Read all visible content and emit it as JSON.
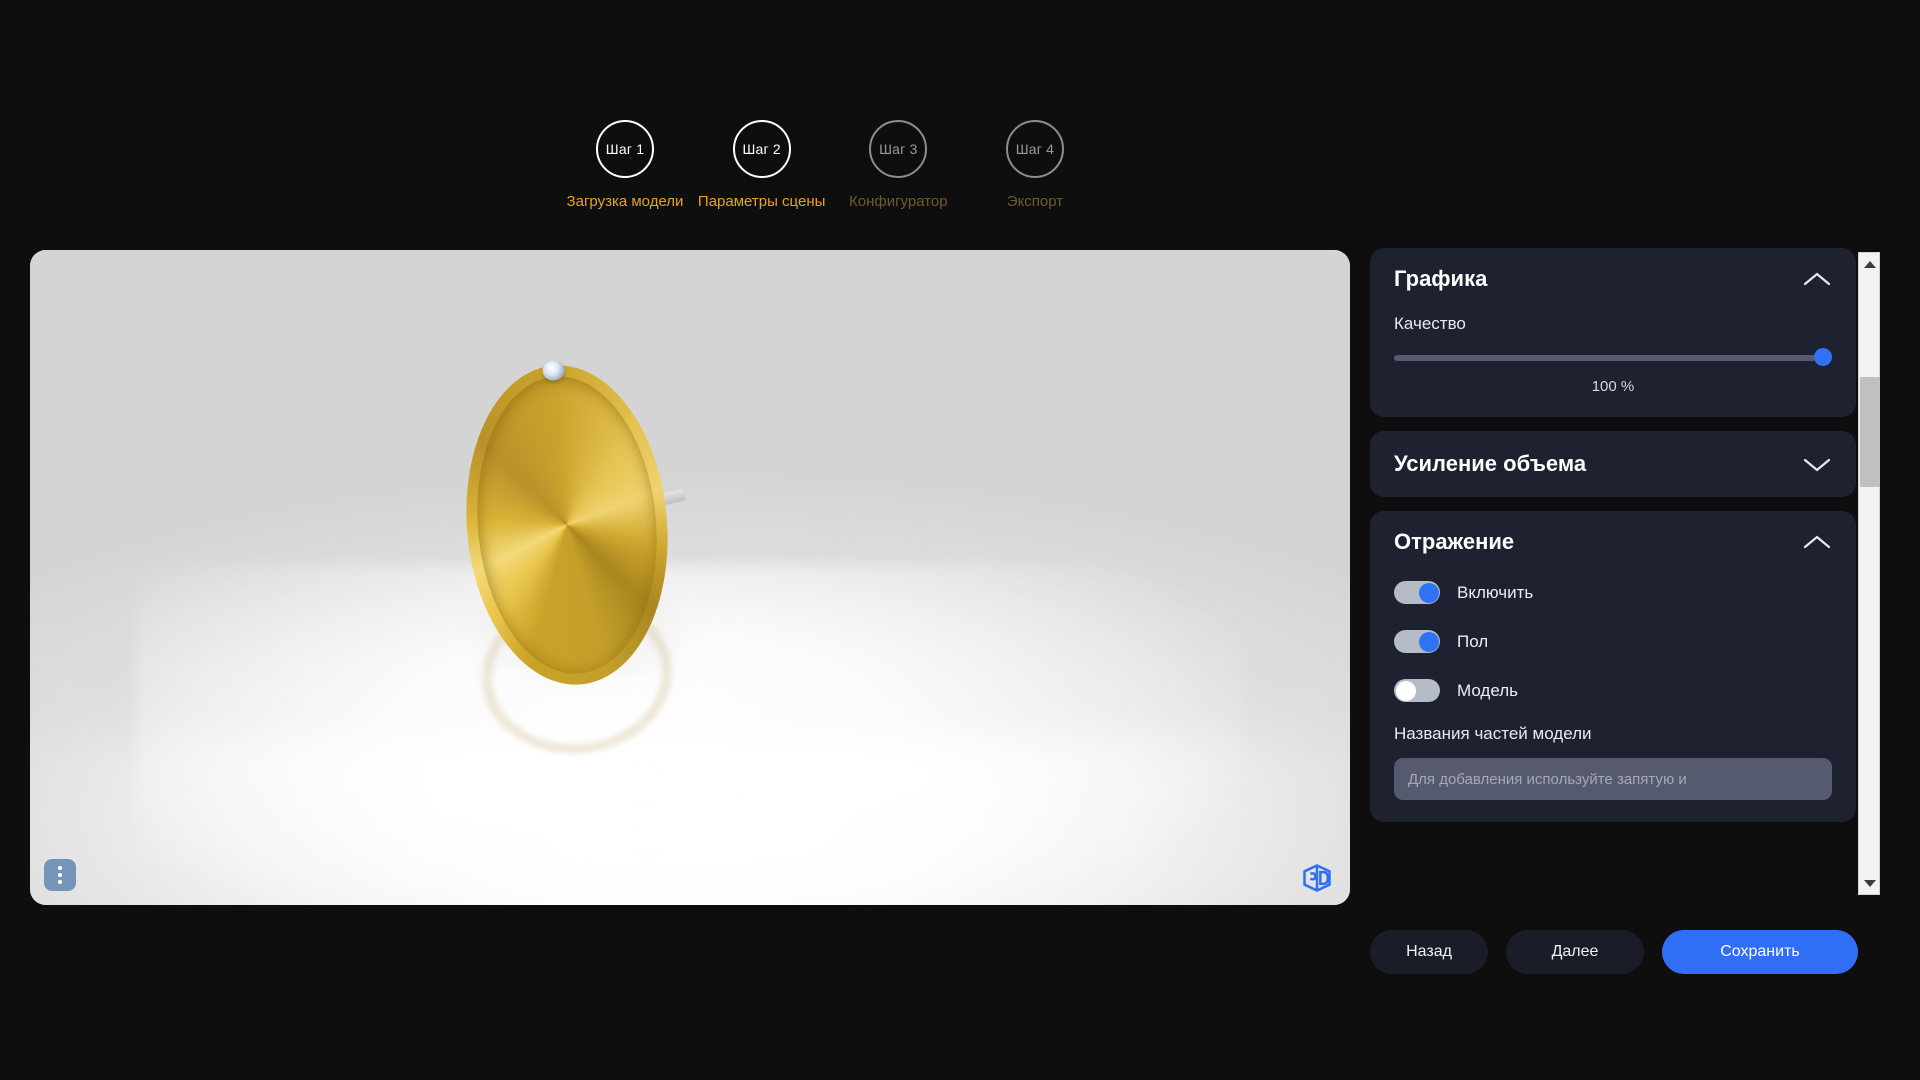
{
  "stepper": {
    "steps": [
      {
        "circle": "Шаг 1",
        "label": "Загрузка модели",
        "state": "active"
      },
      {
        "circle": "Шаг 2",
        "label": "Параметры сцены",
        "state": "active"
      },
      {
        "circle": "Шаг 3",
        "label": "Конфигуратор",
        "state": "inactive"
      },
      {
        "circle": "Шаг 4",
        "label": "Экспорт",
        "state": "inactive"
      }
    ]
  },
  "viewport": {
    "menu_icon": "kebab-menu-icon",
    "logo_text": "3D",
    "model": "gold-diamond-ring"
  },
  "panel": {
    "graphics": {
      "title": "Графика",
      "chevron": "chevron-up-icon",
      "quality_label": "Качество",
      "quality_value": "100 %",
      "quality_percent": 100
    },
    "volume": {
      "title": "Усиление объема",
      "chevron": "chevron-down-icon"
    },
    "reflection": {
      "title": "Отражение",
      "chevron": "chevron-up-icon",
      "toggles": [
        {
          "label": "Включить",
          "on": true
        },
        {
          "label": "Пол",
          "on": true
        },
        {
          "label": "Модель",
          "on": false
        }
      ],
      "parts_label": "Названия частей модели",
      "parts_placeholder": "Для добавления используйте запятую и",
      "parts_value": ""
    }
  },
  "scrollbar": {
    "up_icon": "scroll-up-arrow-icon",
    "down_icon": "scroll-down-arrow-icon"
  },
  "footer": {
    "back": "Назад",
    "next": "Далее",
    "save": "Сохранить"
  },
  "colors": {
    "accent_blue": "#2f6ef5",
    "step_gold": "#e8a317",
    "step_gold_dim": "#6f5a28",
    "card_bg": "#1d2130",
    "page_bg": "#0e0e0f",
    "input_bg": "#555a6e"
  }
}
